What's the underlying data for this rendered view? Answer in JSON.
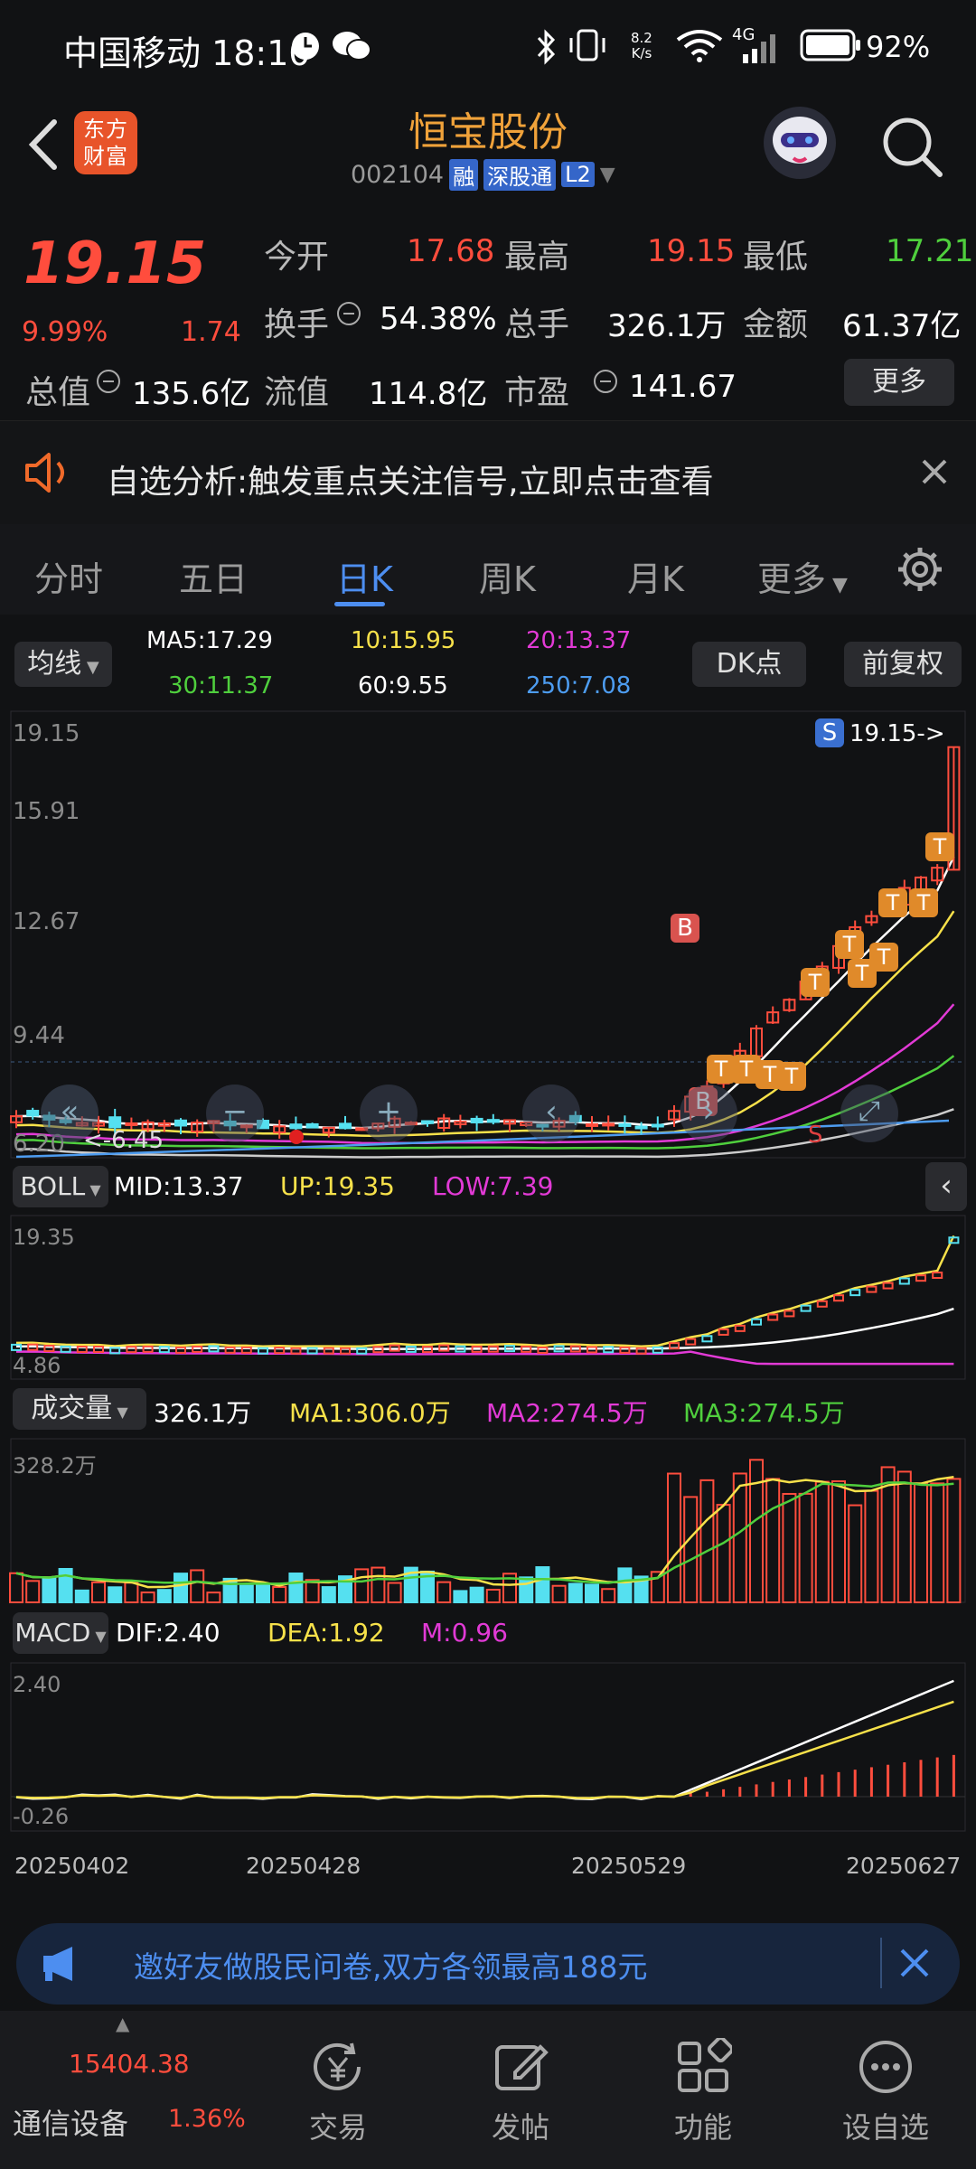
{
  "status_bar": {
    "carrier_time": "中国移动 18:10",
    "speed_top": "8.2",
    "speed_bottom": "K/s",
    "network": "4G",
    "battery": "92%"
  },
  "header": {
    "logo_text": "东方财富",
    "stock_name": "恒宝股份",
    "stock_code": "002104",
    "badge_margin": "融",
    "badge_connect": "深股通",
    "badge_level": "L2"
  },
  "quote": {
    "price": "19.15",
    "change_pct": "9.99%",
    "change_amt": "1.74",
    "fields": [
      {
        "label": "今开",
        "value": "17.68",
        "color": "red"
      },
      {
        "label": "最高",
        "value": "19.15",
        "color": "red"
      },
      {
        "label": "最低",
        "value": "17.21",
        "color": "green"
      },
      {
        "label": "换手",
        "value": "54.38%",
        "color": "white"
      },
      {
        "label": "总手",
        "value": "326.1万",
        "color": "white"
      },
      {
        "label": "金额",
        "value": "61.37亿",
        "color": "white"
      },
      {
        "label": "总值",
        "value": "135.6亿",
        "color": "white"
      },
      {
        "label": "流值",
        "value": "114.8亿",
        "color": "white"
      },
      {
        "label": "市盈",
        "value": "141.67",
        "color": "white"
      }
    ],
    "more_button": "更多"
  },
  "notice": {
    "text": "自选分析:触发重点关注信号,立即点击查看"
  },
  "tabs": [
    "分时",
    "五日",
    "日K",
    "周K",
    "月K",
    "更多"
  ],
  "active_tab": "日K",
  "ma_bar": {
    "selector": "均线",
    "items": [
      {
        "text": "MA5:17.29",
        "color": "#ffffff"
      },
      {
        "text": "10:15.95",
        "color": "#f7e14a"
      },
      {
        "text": "20:13.37",
        "color": "#e23ad6"
      },
      {
        "text": "30:11.37",
        "color": "#4fcf3d"
      },
      {
        "text": "60:9.55",
        "color": "#ffffff"
      },
      {
        "text": "250:7.08",
        "color": "#4d9cf0"
      }
    ],
    "dk_button": "DK点",
    "adjust_button": "前复权"
  },
  "kline": {
    "y_labels": [
      "19.15",
      "15.91",
      "12.67",
      "9.44",
      "6.20"
    ],
    "low_marker": "<-6.45",
    "high_marker": "19.15->",
    "s_tag": "S",
    "b_tag": "B",
    "t_tag": "T",
    "s_small": "S"
  },
  "boll": {
    "selector": "BOLL",
    "mid": "MID:13.37",
    "up": "UP:19.35",
    "low": "LOW:7.39",
    "y_top": "19.35",
    "y_bottom": "4.86"
  },
  "volume": {
    "selector": "成交量",
    "value": "326.1万",
    "ma1": "MA1:306.0万",
    "ma2": "MA2:274.5万",
    "ma3": "MA3:274.5万",
    "y_top": "328.2万"
  },
  "macd": {
    "selector": "MACD",
    "dif": "DIF:2.40",
    "dea": "DEA:1.92",
    "m": "M:0.96",
    "y_top": "2.40",
    "y_bottom": "-0.26"
  },
  "dates": [
    "20250402",
    "20250428",
    "20250529",
    "20250627"
  ],
  "banner": {
    "text": "邀好友做股民问卷,双方各领最高188元"
  },
  "tabbar": {
    "index_value": "15404.38",
    "index_name": "通信设备",
    "index_pct": "1.36%",
    "items": [
      "交易",
      "发帖",
      "功能",
      "设自选"
    ]
  },
  "colors": {
    "up": "#ff4d3d",
    "down": "#55e0f0",
    "accent": "#4d8ef0",
    "orange": "#f08a20"
  }
}
